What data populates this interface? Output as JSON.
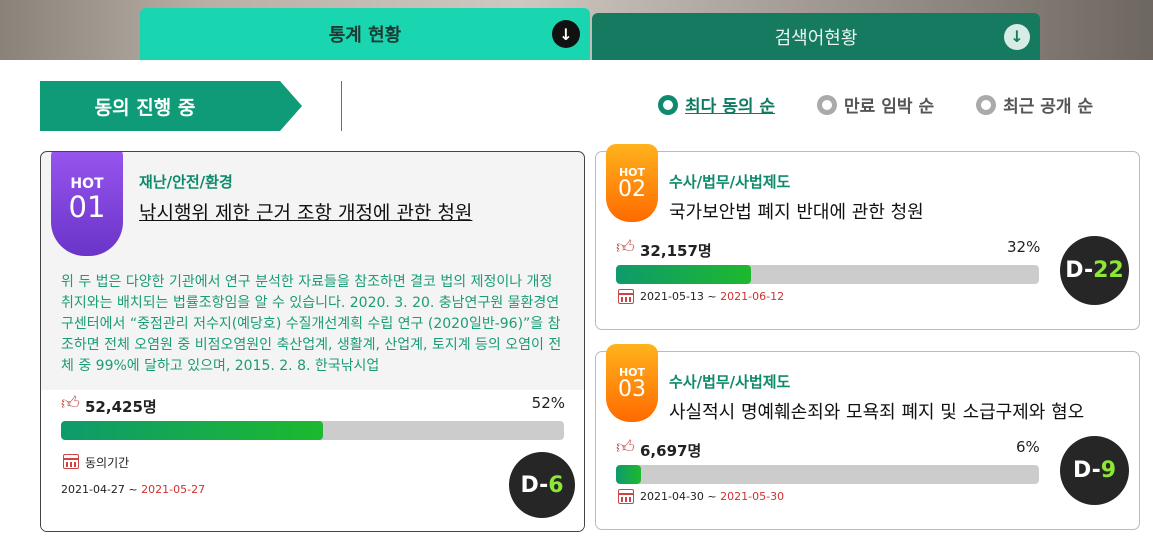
{
  "tabs": [
    {
      "label": "통계 현황",
      "icon": "download-arrow-icon"
    },
    {
      "label": "검색어현황",
      "icon": "download-arrow-icon"
    }
  ],
  "section": {
    "title": "동의 진행 중"
  },
  "sort_options": [
    {
      "label": "최다 동의 순",
      "selected": true
    },
    {
      "label": "만료 임박 순",
      "selected": false
    },
    {
      "label": "최근 공개 순",
      "selected": false
    }
  ],
  "petitions": [
    {
      "hot_label": "HOT",
      "rank": "01",
      "category": "재난/안전/환경",
      "title": "낚시행위 제한 근거 조항 개정에 관한 청원",
      "excerpt": "위 두 법은 다양한 기관에서 연구 분석한 자료들을 참조하면 결코 법의 제정이나 개정 취지와는 배치되는 법률조항임을 알 수 있습니다. 2020. 3. 20. 충남연구원 물환경연구센터에서 “중점관리 저수지(예당호) 수질개선계획 수립 연구 (2020일반-96)”을 참조하면 전체 오염원 중 비점오염원인 축산업계, 생활계, 산업계, 토지계 등의 오염이 전체 중 99%에 달하고 있으며, 2015. 2. 8. 한국낚시업",
      "count": "52,425명",
      "percent": "52%",
      "progress": 0.52,
      "period_label": "동의기간",
      "start_date": "2021-04-27",
      "date_sep": " ~ ",
      "end_date": "2021-05-27",
      "dday_prefix": "D-",
      "dday_num": "6"
    },
    {
      "hot_label": "HOT",
      "rank": "02",
      "category": "수사/법무/사법제도",
      "title": "국가보안법 폐지 반대에 관한 청원",
      "count": "32,157명",
      "percent": "32%",
      "progress": 0.32,
      "start_date": "2021-05-13",
      "date_sep": " ~ ",
      "end_date": "2021-06-12",
      "dday_prefix": "D-",
      "dday_num": "22"
    },
    {
      "hot_label": "HOT",
      "rank": "03",
      "category": "수사/법무/사법제도",
      "title": "사실적시 명예훼손죄와 모욕죄 폐지 및 소급구제와 혐오",
      "count": "6,697명",
      "percent": "6%",
      "progress": 0.06,
      "start_date": "2021-04-30",
      "date_sep": " ~ ",
      "end_date": "2021-05-30",
      "dday_prefix": "D-",
      "dday_num": "9"
    }
  ],
  "colors": {
    "brand_green": "#0f9a78",
    "tab_active": "#19d6b0",
    "tab_inactive": "#157a60",
    "hot_purple": "#6a34c9",
    "hot_orange": "#ff6a00",
    "dday_accent": "#8ee636",
    "end_date_red": "#d03030"
  }
}
